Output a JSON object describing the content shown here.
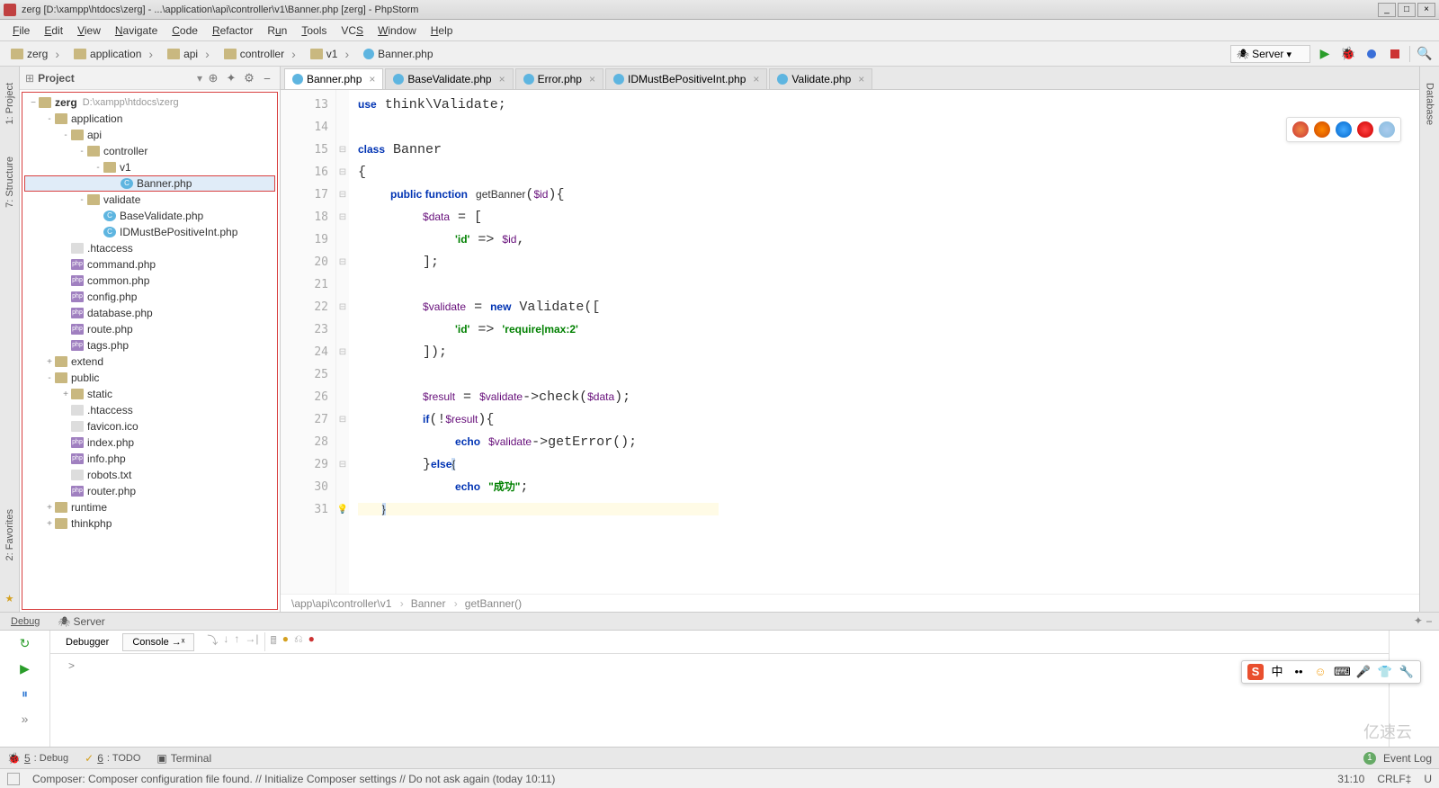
{
  "window": {
    "title": "zerg [D:\\xampp\\htdocs\\zerg] - ...\\application\\api\\controller\\v1\\Banner.php [zerg] - PhpStorm"
  },
  "menu": [
    "File",
    "Edit",
    "View",
    "Navigate",
    "Code",
    "Refactor",
    "Run",
    "Tools",
    "VCS",
    "Window",
    "Help"
  ],
  "breadcrumb": [
    "zerg",
    "application",
    "api",
    "controller",
    "v1",
    "Banner.php"
  ],
  "run_config": "Server",
  "left_tabs": {
    "project": "1: Project",
    "structure": "7: Structure",
    "favorites": "2: Favorites"
  },
  "right_tabs": {
    "database": "Database"
  },
  "project_panel": {
    "title": "Project",
    "root": "zerg",
    "root_path": "D:\\xampp\\htdocs\\zerg"
  },
  "tree": [
    {
      "indent": 1,
      "toggle": "-",
      "icon": "folder",
      "label": "application"
    },
    {
      "indent": 2,
      "toggle": "-",
      "icon": "folder",
      "label": "api"
    },
    {
      "indent": 3,
      "toggle": "-",
      "icon": "folder",
      "label": "controller"
    },
    {
      "indent": 4,
      "toggle": "-",
      "icon": "folder",
      "label": "v1"
    },
    {
      "indent": 5,
      "toggle": "",
      "icon": "file-c",
      "label": "Banner.php",
      "selected": true
    },
    {
      "indent": 3,
      "toggle": "-",
      "icon": "folder",
      "label": "validate"
    },
    {
      "indent": 4,
      "toggle": "",
      "icon": "file-c",
      "label": "BaseValidate.php"
    },
    {
      "indent": 4,
      "toggle": "",
      "icon": "file-c",
      "label": "IDMustBePositiveInt.php"
    },
    {
      "indent": 2,
      "toggle": "",
      "icon": "file-txt",
      "label": ".htaccess"
    },
    {
      "indent": 2,
      "toggle": "",
      "icon": "file-php",
      "label": "command.php"
    },
    {
      "indent": 2,
      "toggle": "",
      "icon": "file-php",
      "label": "common.php"
    },
    {
      "indent": 2,
      "toggle": "",
      "icon": "file-php",
      "label": "config.php"
    },
    {
      "indent": 2,
      "toggle": "",
      "icon": "file-php",
      "label": "database.php"
    },
    {
      "indent": 2,
      "toggle": "",
      "icon": "file-php",
      "label": "route.php"
    },
    {
      "indent": 2,
      "toggle": "",
      "icon": "file-php",
      "label": "tags.php"
    },
    {
      "indent": 1,
      "toggle": "+",
      "icon": "folder",
      "label": "extend"
    },
    {
      "indent": 1,
      "toggle": "-",
      "icon": "folder",
      "label": "public"
    },
    {
      "indent": 2,
      "toggle": "+",
      "icon": "folder",
      "label": "static"
    },
    {
      "indent": 2,
      "toggle": "",
      "icon": "file-txt",
      "label": ".htaccess"
    },
    {
      "indent": 2,
      "toggle": "",
      "icon": "file-txt",
      "label": "favicon.ico"
    },
    {
      "indent": 2,
      "toggle": "",
      "icon": "file-php",
      "label": "index.php"
    },
    {
      "indent": 2,
      "toggle": "",
      "icon": "file-php",
      "label": "info.php"
    },
    {
      "indent": 2,
      "toggle": "",
      "icon": "file-txt",
      "label": "robots.txt"
    },
    {
      "indent": 2,
      "toggle": "",
      "icon": "file-php",
      "label": "router.php"
    },
    {
      "indent": 1,
      "toggle": "+",
      "icon": "folder",
      "label": "runtime"
    },
    {
      "indent": 1,
      "toggle": "+",
      "icon": "folder",
      "label": "thinkphp"
    }
  ],
  "tabs": [
    {
      "label": "Banner.php",
      "active": true
    },
    {
      "label": "BaseValidate.php"
    },
    {
      "label": "Error.php"
    },
    {
      "label": "IDMustBePositiveInt.php"
    },
    {
      "label": "Validate.php"
    }
  ],
  "line_start": 13,
  "line_end": 31,
  "editor_breadcrumb": [
    "\\app\\api\\controller\\v1",
    "Banner",
    "getBanner()"
  ],
  "debug_panels_top": {
    "debug": "Debug",
    "server": "Server"
  },
  "debug_subtabs": {
    "debugger": "Debugger",
    "console": "Console →ˣ"
  },
  "console_prompt": ">",
  "bottom_tabs": {
    "debug": "5: Debug",
    "todo": "6: TODO",
    "terminal": "Terminal"
  },
  "event_log": {
    "count": "1",
    "label": "Event Log"
  },
  "status": {
    "msg": "Composer: Composer configuration file found. // Initialize Composer settings // Do not ask again (today 10:11)",
    "pos": "31:10",
    "eol": "CRLF‡",
    "enc": "U"
  },
  "watermark": "亿速云"
}
